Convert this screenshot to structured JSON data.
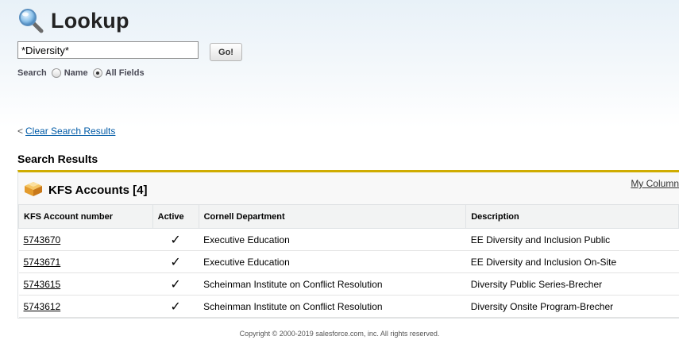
{
  "page": {
    "title": "Lookup",
    "icon": "magnifier-icon"
  },
  "search": {
    "value": "*Diversity*",
    "go_label": "Go!",
    "options_label": "Search",
    "options": [
      {
        "label": "Name",
        "checked": false
      },
      {
        "label": "All Fields",
        "checked": true
      }
    ]
  },
  "clear_link": {
    "prefix": "<",
    "label": "Clear Search Results"
  },
  "results": {
    "heading": "Search Results",
    "object_title": "KFS Accounts [4]",
    "object_icon": "box-icon",
    "my_columns_label": "My Column",
    "columns": [
      "KFS Account number",
      "Active",
      "Cornell Department",
      "Description"
    ],
    "rows": [
      {
        "account": "5743670",
        "active": "✓",
        "department": "Executive Education",
        "description": "EE Diversity and Inclusion Public"
      },
      {
        "account": "5743671",
        "active": "✓",
        "department": "Executive Education",
        "description": "EE Diversity and Inclusion On-Site"
      },
      {
        "account": "5743615",
        "active": "✓",
        "department": "Scheinman Institute on Conflict Resolution",
        "description": "Diversity Public Series-Brecher"
      },
      {
        "account": "5743612",
        "active": "✓",
        "department": "Scheinman Institute on Conflict Resolution",
        "description": "Diversity Onsite Program-Brecher"
      }
    ]
  },
  "footer": {
    "copyright": "Copyright © 2000-2019 salesforce.com, inc. All rights reserved."
  },
  "colors": {
    "accent_bar": "#cfac00",
    "link": "#015ba7",
    "header_band": "#e8f1f8"
  }
}
